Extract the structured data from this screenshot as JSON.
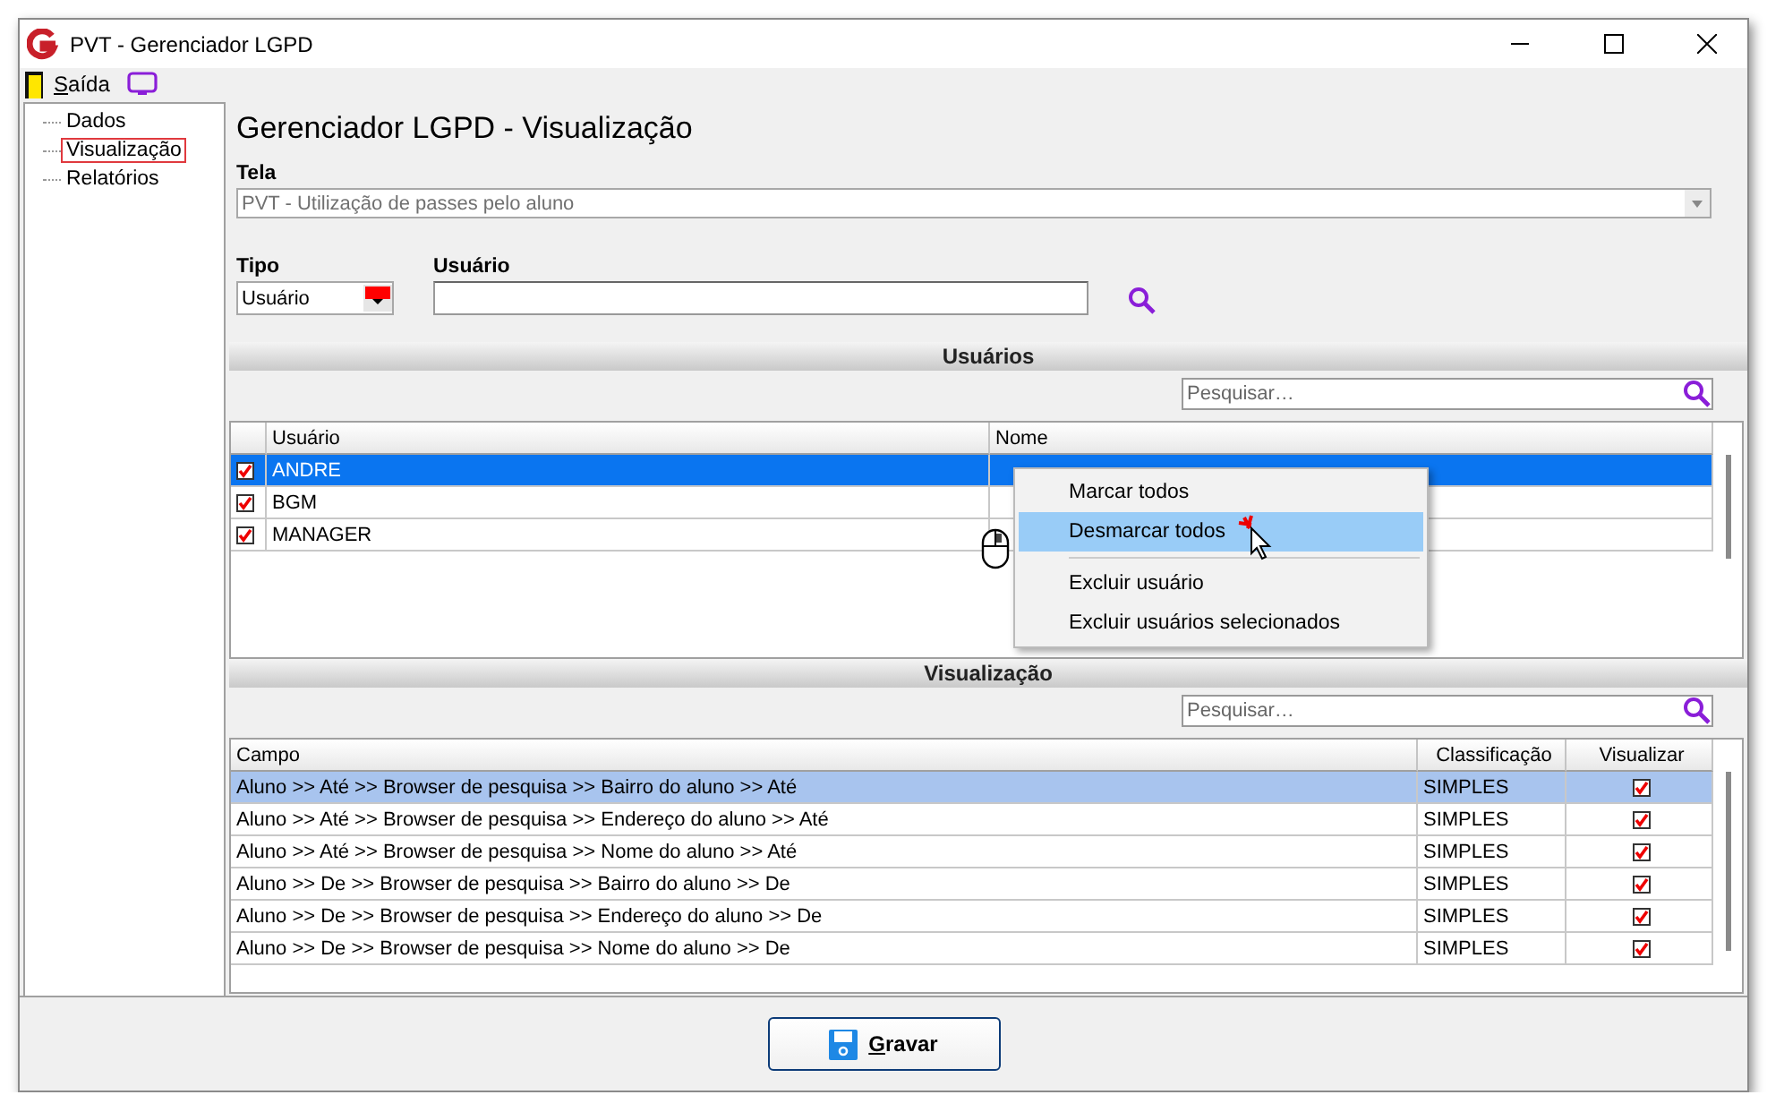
{
  "window": {
    "title": "PVT - Gerenciador LGPD"
  },
  "menu_bar": [
    {
      "label": "Saída"
    }
  ],
  "tree": [
    {
      "label": "Dados",
      "selected": false
    },
    {
      "label": "Visualização",
      "selected": true
    },
    {
      "label": "Relatórios",
      "selected": false
    }
  ],
  "heading": "Gerenciador LGPD - Visualização",
  "tela": {
    "label": "Tela",
    "value": "PVT - Utilização de passes pelo aluno",
    "disabled": true
  },
  "tipo": {
    "label": "Tipo",
    "value": "Usuário"
  },
  "usuario": {
    "label": "Usuário"
  },
  "users_section": {
    "title": "Usuários",
    "search": {
      "placeholder": "Pesquisar…"
    },
    "columns": [
      "Usuário",
      "Nome"
    ],
    "rows": [
      {
        "checked": true,
        "usuario": "ANDRE",
        "selected": true
      },
      {
        "checked": true,
        "usuario": "BGM",
        "selected": false
      },
      {
        "checked": true,
        "usuario": "MANAGER",
        "selected": false
      }
    ]
  },
  "context_menu": {
    "items": [
      {
        "kind": "item",
        "label": "Marcar todos",
        "selected": false
      },
      {
        "kind": "item",
        "label": "Desmarcar todos",
        "selected": true
      },
      {
        "kind": "separator"
      },
      {
        "kind": "item",
        "label": "Excluir usuário",
        "selected": false
      },
      {
        "kind": "item",
        "label": "Excluir usuários selecionados",
        "selected": false
      }
    ]
  },
  "view_section": {
    "title": "Visualização",
    "search": {
      "placeholder": "Pesquisar…"
    },
    "columns": [
      "Campo",
      "Classificação",
      "Visualizar"
    ],
    "rows": [
      {
        "campo": "Aluno >> Até >> Browser de pesquisa >> Bairro do aluno >> Até",
        "classificacao": "SIMPLES",
        "visualizar": true,
        "selected": true
      },
      {
        "campo": "Aluno >> Até >> Browser de pesquisa >> Endereço do aluno >> Até",
        "classificacao": "SIMPLES",
        "visualizar": true,
        "selected": false
      },
      {
        "campo": "Aluno >> Até >> Browser de pesquisa >> Nome do aluno >> Até",
        "classificacao": "SIMPLES",
        "visualizar": true,
        "selected": false
      },
      {
        "campo": "Aluno >> De >> Browser de pesquisa >> Bairro do aluno >> De",
        "classificacao": "SIMPLES",
        "visualizar": true,
        "selected": false
      },
      {
        "campo": "Aluno >> De >> Browser de pesquisa >> Endereço do aluno >> De",
        "classificacao": "SIMPLES",
        "visualizar": true,
        "selected": false
      },
      {
        "campo": "Aluno >> De >> Browser de pesquisa >> Nome do aluno >> De",
        "classificacao": "SIMPLES",
        "visualizar": true,
        "selected": false
      }
    ]
  },
  "save_button": {
    "label": "Gravar"
  }
}
